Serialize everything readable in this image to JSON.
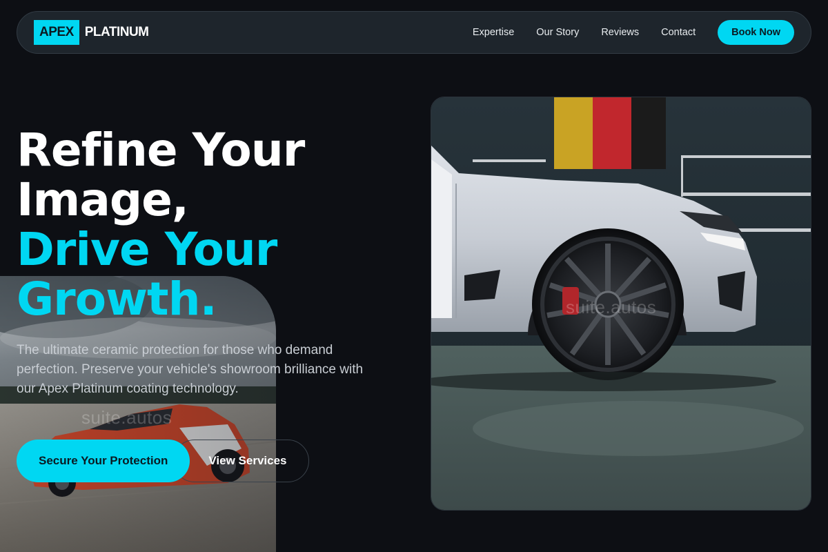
{
  "brand": {
    "badge": "APEX",
    "name": "PLATINUM"
  },
  "nav": {
    "links": [
      "Expertise",
      "Our Story",
      "Reviews",
      "Contact"
    ],
    "book_label": "Book Now"
  },
  "hero": {
    "line1": "Refine Your",
    "line2": "Image,",
    "line3": "Drive Your",
    "line4": "Growth.",
    "description": "The ultimate ceramic protection for those who demand perfection. Preserve your vehicle's showroom brilliance with our Apex Platinum coating technology.",
    "primary_cta": "Secure Your Protection",
    "secondary_cta": "View Services"
  },
  "watermark": "suite.autos",
  "images": {
    "left": "orange race car on track photo",
    "right": "white sports car in garage photo"
  },
  "colors": {
    "accent": "#00d7f2",
    "background": "#0d0f14",
    "nav_bg": "#1e252c"
  }
}
